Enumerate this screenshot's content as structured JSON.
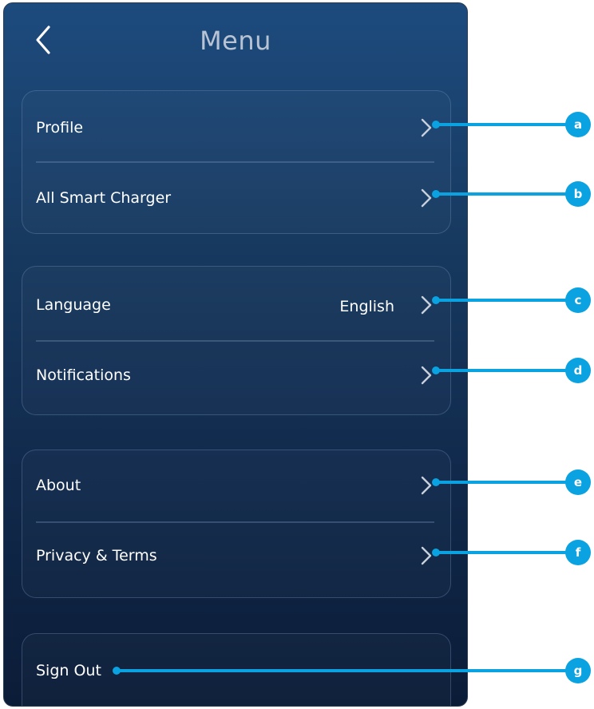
{
  "header": {
    "title": "Menu",
    "back_icon": "chevron-left-icon"
  },
  "groups": [
    {
      "items": [
        {
          "label": "Profile"
        },
        {
          "label": "All Smart Charger"
        }
      ]
    },
    {
      "items": [
        {
          "label": "Language",
          "value": "English"
        },
        {
          "label": "Notifications"
        }
      ]
    },
    {
      "items": [
        {
          "label": "About"
        },
        {
          "label": "Privacy & Terms"
        }
      ]
    },
    {
      "items": [
        {
          "label": "Sign Out"
        }
      ]
    }
  ],
  "callouts": [
    "a",
    "b",
    "c",
    "d",
    "e",
    "f",
    "g"
  ],
  "colors": {
    "callout": "#0aa2e0",
    "background_top": "#1d4b7e",
    "background_bottom": "#0b1c37",
    "text": "#ffffff",
    "title": "#b8c3d3"
  }
}
